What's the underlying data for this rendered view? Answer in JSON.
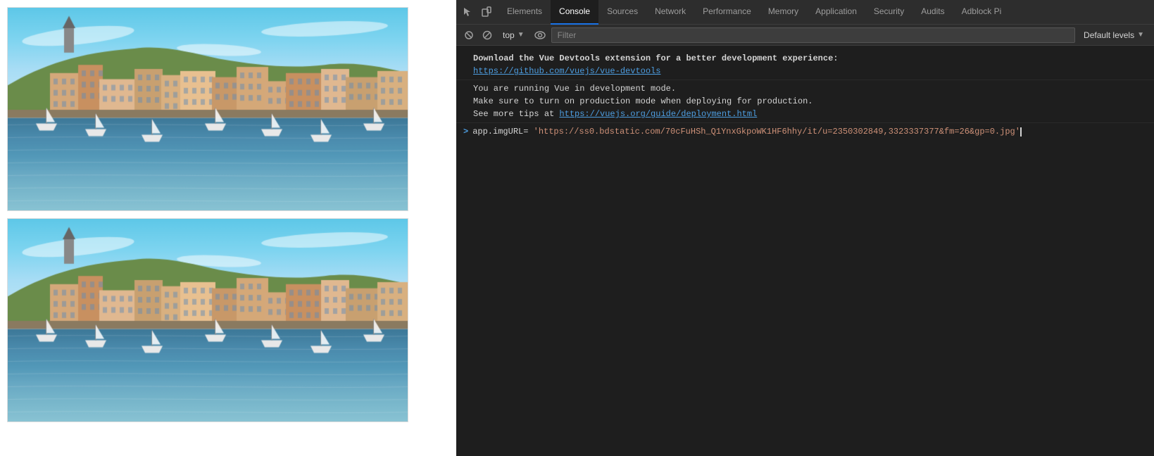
{
  "webpage": {
    "images": [
      "cityscape-1",
      "cityscape-2"
    ]
  },
  "devtools": {
    "toolbar_icons": [
      {
        "name": "cursor-icon",
        "symbol": "↖"
      },
      {
        "name": "device-icon",
        "symbol": "⬜"
      }
    ],
    "tabs": [
      {
        "id": "elements",
        "label": "Elements",
        "active": false
      },
      {
        "id": "console",
        "label": "Console",
        "active": true
      },
      {
        "id": "sources",
        "label": "Sources",
        "active": false
      },
      {
        "id": "network",
        "label": "Network",
        "active": false
      },
      {
        "id": "performance",
        "label": "Performance",
        "active": false
      },
      {
        "id": "memory",
        "label": "Memory",
        "active": false
      },
      {
        "id": "application",
        "label": "Application",
        "active": false
      },
      {
        "id": "security",
        "label": "Security",
        "active": false
      },
      {
        "id": "audits",
        "label": "Audits",
        "active": false
      },
      {
        "id": "adblock",
        "label": "Adblock Pi",
        "active": false
      }
    ],
    "console": {
      "context": "top",
      "filter_placeholder": "Filter",
      "default_levels": "Default levels",
      "messages": [
        {
          "type": "info",
          "bold_text": "Download the Vue Devtools extension for a better development experience:",
          "link_text": "https://github.com/vuejs/vue-devtools",
          "link_url": "https://github.com/vuejs/vue-devtools"
        },
        {
          "type": "info",
          "text_line1": "You are running Vue in development mode.",
          "text_line2": "Make sure to turn on production mode when deploying for production.",
          "text_line3": "See more tips at ",
          "link_text": "https://vuejs.org/guide/deployment.html",
          "link_url": "https://vuejs.org/guide/deployment.html"
        },
        {
          "type": "expression",
          "prompt": ">",
          "text": "app.imgURL= 'https://ss0.bdstatic.com/70cFuHSh_Q1YnxGkpoWK1HF6hhy/it/u=2350302849,3323337377&fm=26&gp=0.jpg'"
        }
      ]
    }
  }
}
